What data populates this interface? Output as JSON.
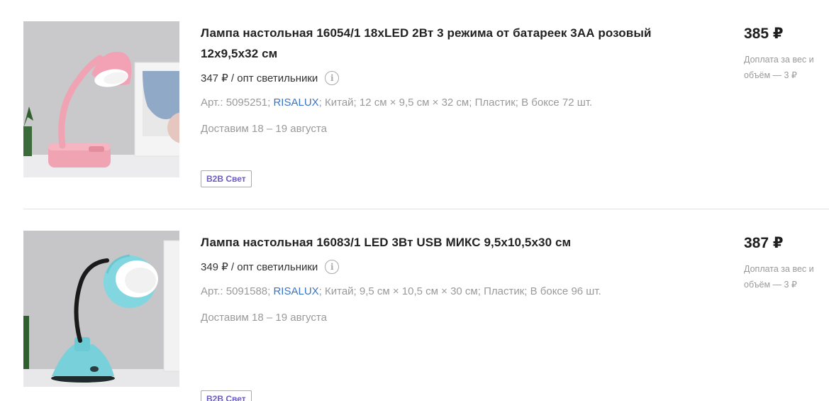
{
  "products": [
    {
      "title": "Лампа настольная 16054/1 18xLED 2Вт 3 режима от батареек 3АА розовый 12х9,5х32 см",
      "wholesale_price": "347 ₽ / опт светильники",
      "info_icon": "info-icon",
      "specs_prefix": "Арт.: 5095251; ",
      "brand": "RISALUX",
      "specs_suffix": "; Китай; 12 см × 9,5 см × 32 см; Пластик; В боксе 72 шт.",
      "delivery": "Доставим 18 – 19 августа",
      "badge": "B2B Свет",
      "price": "385 ₽",
      "surcharge": "Доплата за вес и объём — 3 ₽",
      "image_alt": "pink desk lamp",
      "color": "#f2a6b4"
    },
    {
      "title": "Лампа настольная 16083/1 LED 3Вт USB МИКС 9,5х10,5х30 см",
      "wholesale_price": "349 ₽ / опт светильники",
      "info_icon": "info-icon",
      "specs_prefix": "Арт.: 5091588; ",
      "brand": "RISALUX",
      "specs_suffix": "; Китай; 9,5 см × 10,5 см × 30 см; Пластик; В боксе 96 шт.",
      "delivery": "Доставим 18 – 19 августа",
      "badge": "B2B Свет",
      "price": "387 ₽",
      "surcharge": "Доплата за вес и объём — 3 ₽",
      "image_alt": "turquoise desk lamp",
      "color": "#7fd3dc"
    }
  ],
  "colors": {
    "brand_link": "#3a73c4",
    "badge_text": "#6a5bc4",
    "muted": "#9a9a9a"
  }
}
